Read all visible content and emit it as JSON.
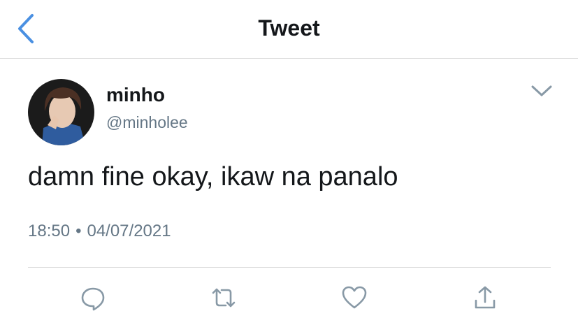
{
  "header": {
    "title": "Tweet",
    "back_icon": "chevron-left-icon"
  },
  "tweet": {
    "author_name": "minho",
    "author_handle": "@minholee",
    "text": "damn fine okay, ikaw na panalo",
    "time": "18:50",
    "separator": "•",
    "date": "04/07/2021"
  },
  "actions": {
    "reply_icon": "comment-icon",
    "retweet_icon": "retweet-icon",
    "like_icon": "heart-icon",
    "share_icon": "share-icon"
  },
  "colors": {
    "accent": "#4a90e2",
    "text": "#14171a",
    "secondary": "#657786",
    "icon": "#8899a6",
    "divider": "#d9d9d9"
  }
}
